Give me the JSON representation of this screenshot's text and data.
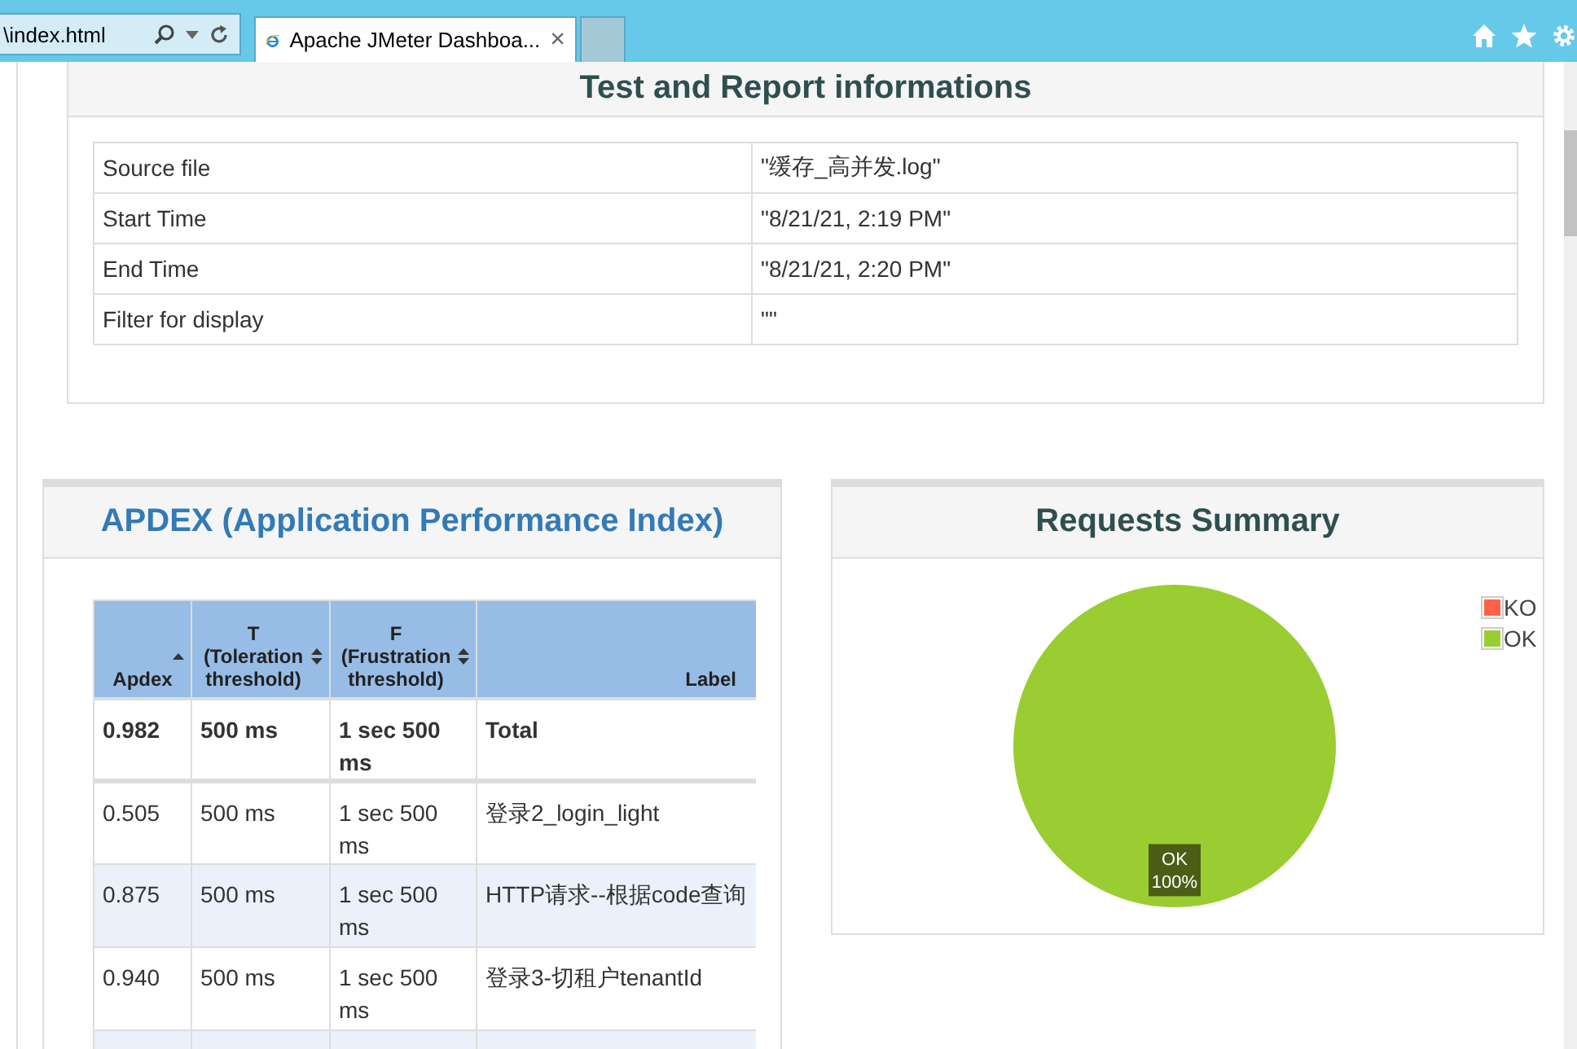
{
  "browser": {
    "address": "\\index.html",
    "tab_title": "Apache JMeter Dashboa...",
    "tab_close": "×"
  },
  "report_info": {
    "title": "Test and Report informations",
    "rows": [
      {
        "name": "Source file",
        "value": "\"缓存_高并发.log\""
      },
      {
        "name": "Start Time",
        "value": "\"8/21/21, 2:19 PM\""
      },
      {
        "name": "End Time",
        "value": "\"8/21/21, 2:20 PM\""
      },
      {
        "name": "Filter for display",
        "value": "\"\""
      }
    ]
  },
  "apdex": {
    "title": "APDEX (Application Performance Index)",
    "columns": [
      {
        "label": "Apdex",
        "sorted": true
      },
      {
        "label": "T (Toleration threshold)",
        "sorted": false
      },
      {
        "label": "F (Frustration threshold)",
        "sorted": false
      },
      {
        "label": "Label"
      }
    ],
    "rows": [
      {
        "cells": [
          "0.982",
          "500 ms",
          "1 sec 500 ms",
          "Total"
        ],
        "kind": "total"
      },
      {
        "cells": [
          "0.505",
          "500 ms",
          "1 sec 500 ms",
          "登录2_login_light"
        ],
        "kind": "item"
      },
      {
        "cells": [
          "0.875",
          "500 ms",
          "1 sec 500 ms",
          "HTTP请求--根据code查询"
        ],
        "kind": "item"
      },
      {
        "cells": [
          "0.940",
          "500 ms",
          "1 sec 500 ms",
          "登录3-切租户tenantId"
        ],
        "kind": "item"
      }
    ]
  },
  "requests_summary": {
    "title": "Requests Summary",
    "chart_data": {
      "type": "pie",
      "categories": [
        "KO",
        "OK"
      ],
      "values": [
        0,
        100
      ],
      "colors": [
        "#ff6347",
        "#9acd32"
      ],
      "value_labels": [
        null,
        "OK 100%"
      ]
    }
  }
}
